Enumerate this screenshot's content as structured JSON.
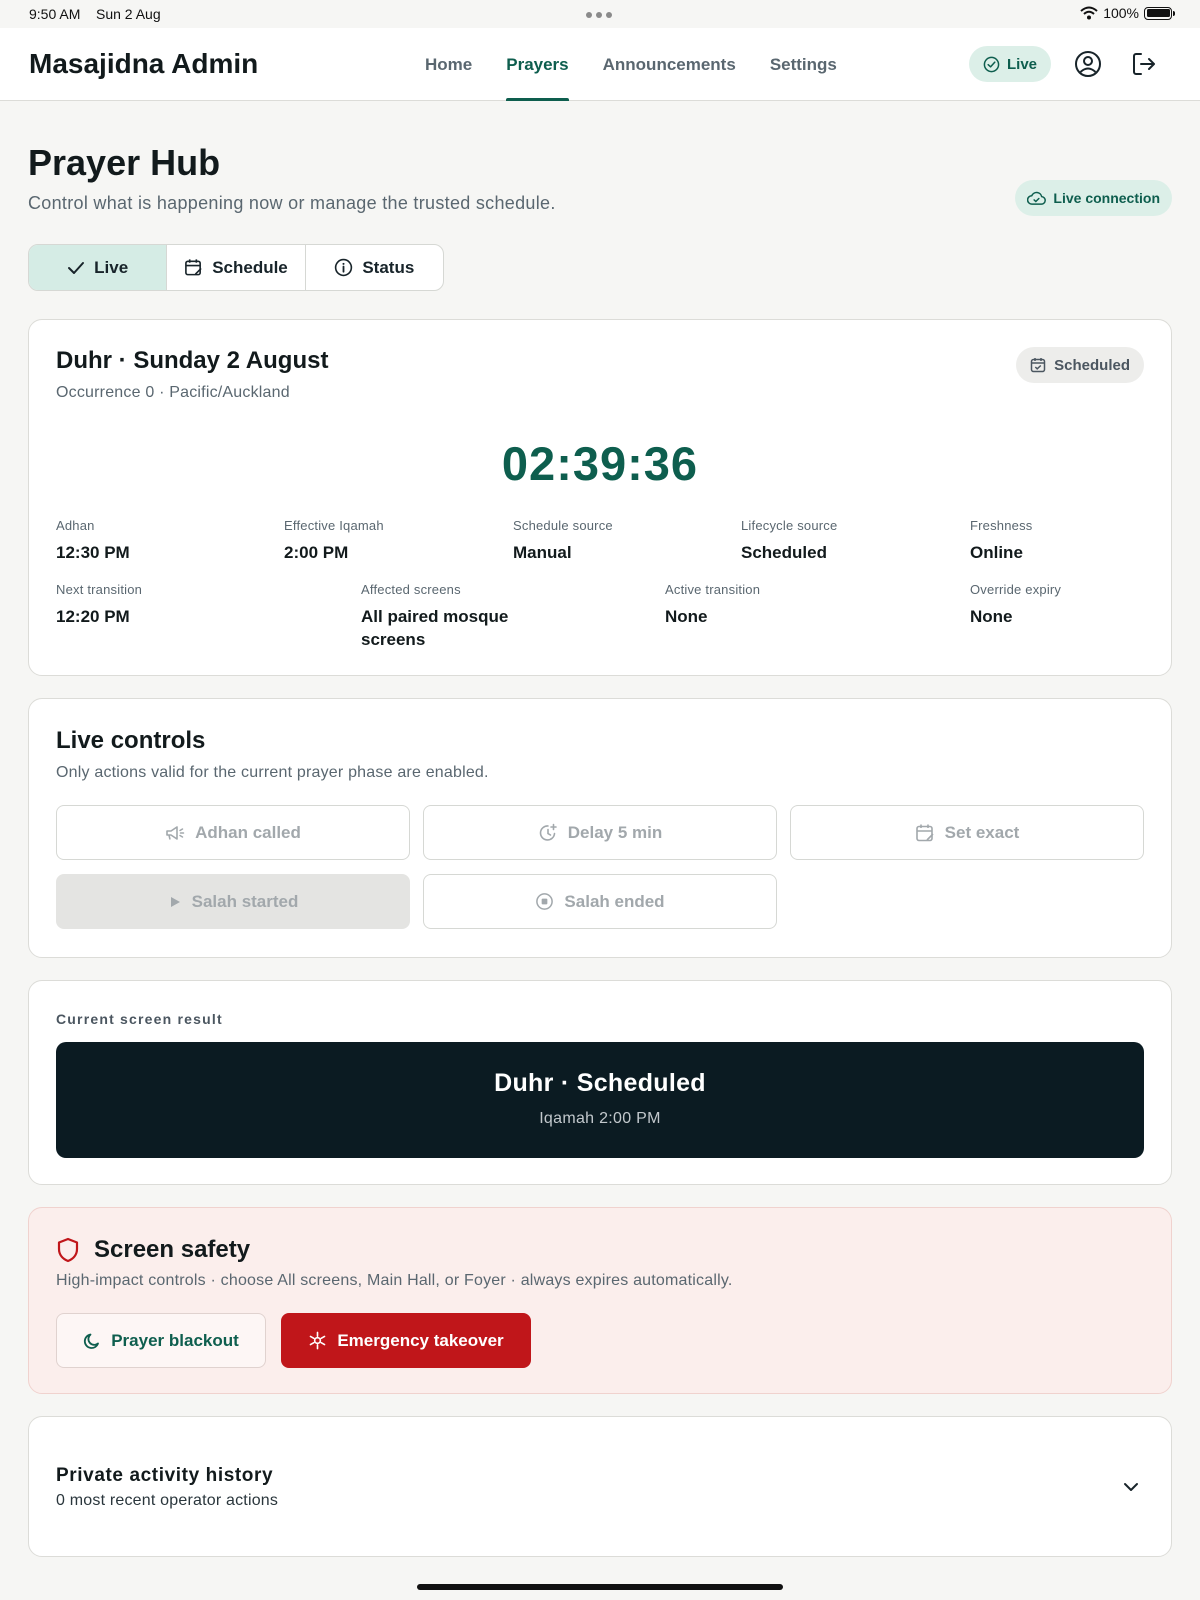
{
  "status_bar": {
    "time": "9:50 AM",
    "date": "Sun 2 Aug",
    "battery": "100%"
  },
  "app": {
    "title": "Masajidna Admin"
  },
  "nav": {
    "links": [
      {
        "label": "Home",
        "active": false
      },
      {
        "label": "Prayers",
        "active": true
      },
      {
        "label": "Announcements",
        "active": false
      },
      {
        "label": "Settings",
        "active": false
      }
    ],
    "live_label": "Live"
  },
  "header": {
    "title": "Prayer Hub",
    "subtitle": "Control what is happening now or manage the trusted schedule.",
    "connection_label": "Live connection"
  },
  "tabs": [
    {
      "label": "Live",
      "icon": "check-icon",
      "active": true
    },
    {
      "label": "Schedule",
      "icon": "calendar-edit-icon",
      "active": false
    },
    {
      "label": "Status",
      "icon": "info-icon",
      "active": false
    }
  ],
  "prayer": {
    "title": "Duhr · Sunday 2 August",
    "subtitle": "Occurrence 0 · Pacific/Auckland",
    "state_badge": "Scheduled",
    "countdown": "02:39:36",
    "stats_row1": [
      {
        "label": "Adhan",
        "value": "12:30 PM"
      },
      {
        "label": "Effective Iqamah",
        "value": "2:00 PM"
      },
      {
        "label": "Schedule source",
        "value": "Manual"
      },
      {
        "label": "Lifecycle source",
        "value": "Scheduled"
      },
      {
        "label": "Freshness",
        "value": "Online"
      }
    ],
    "stats_row2": [
      {
        "label": "Next transition",
        "value": "12:20 PM"
      },
      {
        "label": "Affected screens",
        "value": "All paired mosque screens"
      },
      {
        "label": "Active transition",
        "value": "None"
      },
      {
        "label": "Override expiry",
        "value": "None"
      }
    ]
  },
  "live_controls": {
    "title": "Live controls",
    "subtitle": "Only actions valid for the current prayer phase are enabled.",
    "buttons": [
      {
        "label": "Adhan called",
        "icon": "megaphone-icon",
        "enabled": false
      },
      {
        "label": "Delay 5 min",
        "icon": "clock-plus-icon",
        "enabled": false
      },
      {
        "label": "Set exact",
        "icon": "calendar-edit-icon",
        "enabled": false
      },
      {
        "label": "Salah started",
        "icon": "play-icon",
        "enabled": false
      },
      {
        "label": "Salah ended",
        "icon": "stop-circle-icon",
        "enabled": false
      }
    ]
  },
  "screen_result": {
    "label": "Current screen result",
    "main": "Duhr · Scheduled",
    "sub": "Iqamah 2:00 PM"
  },
  "safety": {
    "title": "Screen safety",
    "subtitle": "High-impact controls · choose All screens, Main Hall, or Foyer · always expires automatically.",
    "blackout_label": "Prayer blackout",
    "emergency_label": "Emergency takeover"
  },
  "history": {
    "title": "Private activity history",
    "subtitle": "0 most recent operator actions"
  },
  "colors": {
    "accent": "#0e5e4e",
    "accent_soft": "#dcefe8",
    "danger": "#c0161a",
    "dark_panel": "#0b1b22"
  }
}
